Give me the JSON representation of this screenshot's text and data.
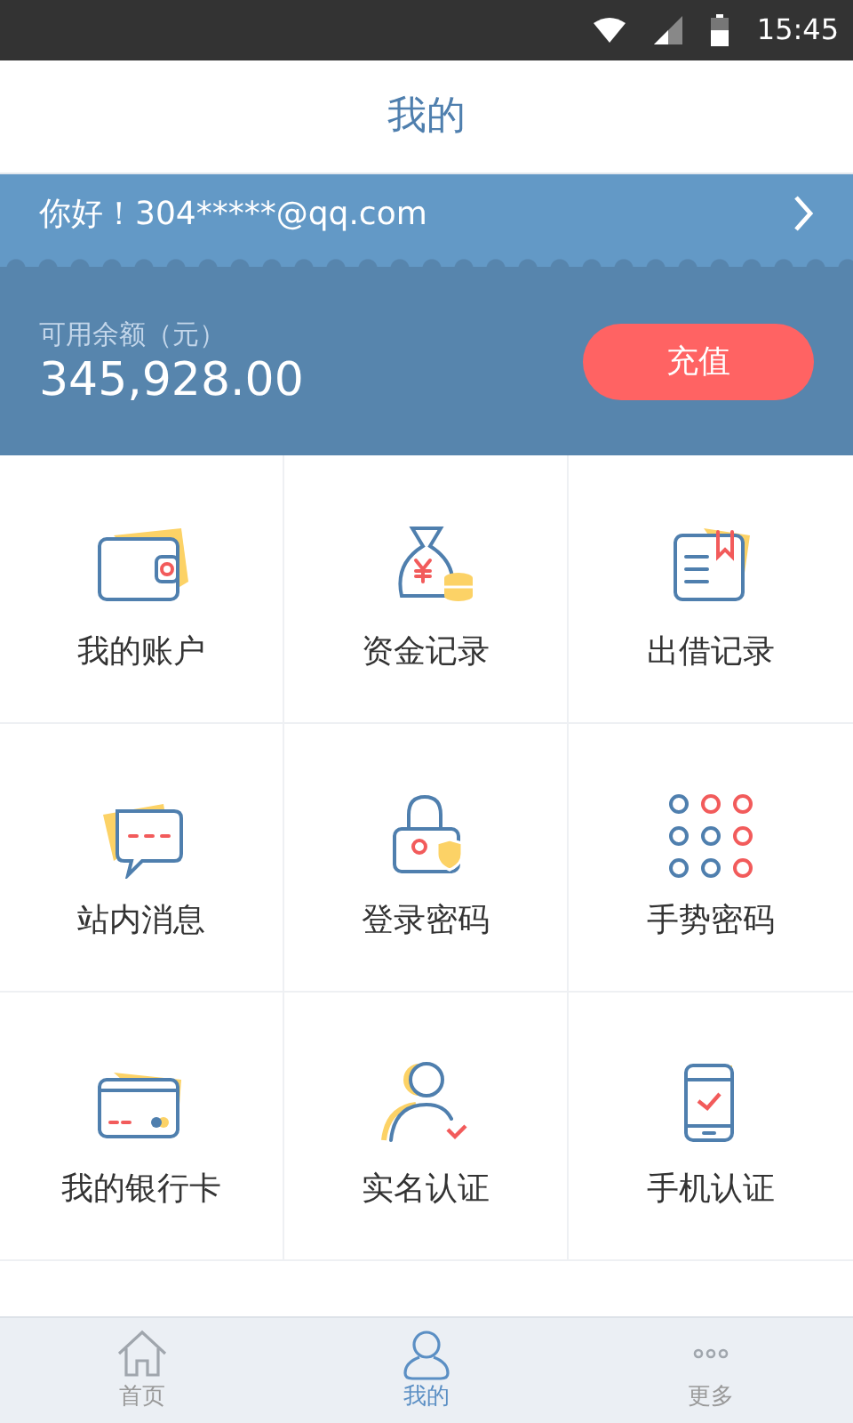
{
  "status_bar": {
    "time": "15:45"
  },
  "header": {
    "title": "我的"
  },
  "account": {
    "greeting": "你好！304*****@qq.com",
    "balance_label": "可用余额（元）",
    "balance": "345,928.00",
    "recharge_button": "充值"
  },
  "menu": [
    {
      "label": "我的账户"
    },
    {
      "label": "资金记录"
    },
    {
      "label": "出借记录"
    },
    {
      "label": "站内消息"
    },
    {
      "label": "登录密码"
    },
    {
      "label": "手势密码"
    },
    {
      "label": "我的银行卡"
    },
    {
      "label": "实名认证"
    },
    {
      "label": "手机认证"
    }
  ],
  "tab_bar": [
    {
      "label": "首页",
      "selected": false
    },
    {
      "label": "我的",
      "selected": true
    },
    {
      "label": "更多",
      "selected": false
    }
  ]
}
